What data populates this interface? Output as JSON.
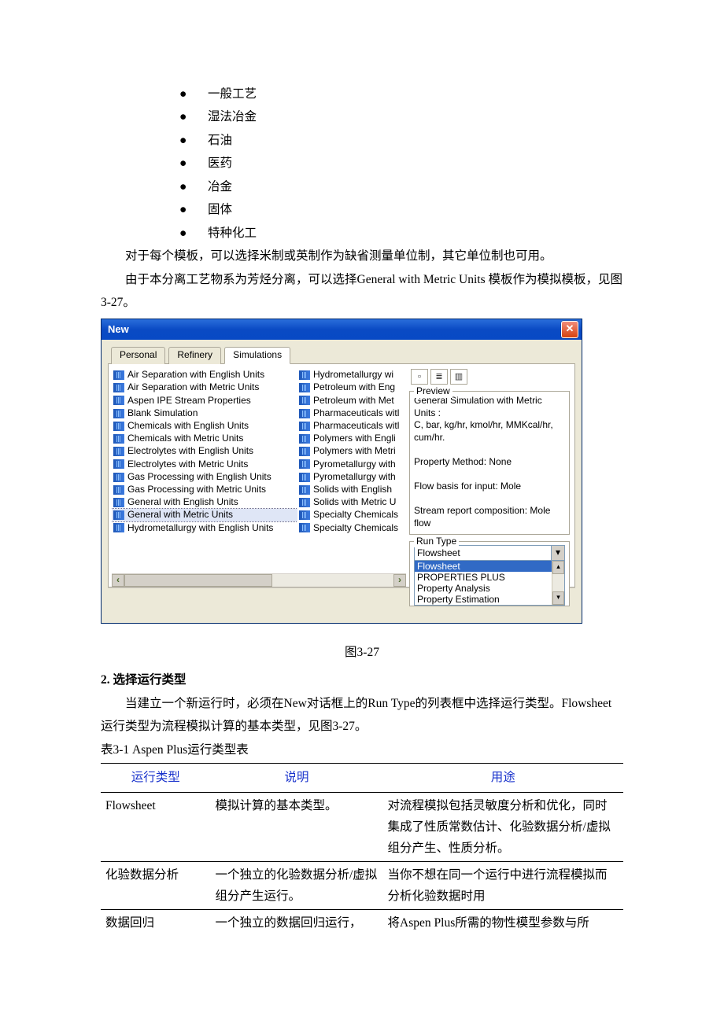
{
  "bullets": [
    "一般工艺",
    "湿法冶金",
    "石油",
    "医药",
    "冶金",
    "固体",
    "特种化工"
  ],
  "para1": "对于每个模板，可以选择米制或英制作为缺省测量单位制，其它单位制也可用。",
  "para2": "由于本分离工艺物系为芳烃分离，可以选择General with Metric Units 模板作为模拟模板，见图3-27。",
  "dialog": {
    "title": "New",
    "tabs": [
      "Personal",
      "Refinery",
      "Simulations"
    ],
    "active_tab": 2,
    "col1": [
      "Air Separation with English Units",
      "Air Separation with Metric Units",
      "Aspen IPE Stream Properties",
      "Blank Simulation",
      "Chemicals with English Units",
      "Chemicals with Metric Units",
      "Electrolytes with English Units",
      "Electrolytes with Metric Units",
      "Gas Processing with English Units",
      "Gas Processing with Metric Units",
      "General with English Units",
      "General with Metric Units",
      "Hydrometallurgy with English Units"
    ],
    "selected_index": 11,
    "col2": [
      "Hydrometallurgy wi",
      "Petroleum with Eng",
      "Petroleum with Met",
      "Pharmaceuticals witl",
      "Pharmaceuticals witl",
      "Polymers with Engli",
      "Polymers with Metri",
      "Pyrometallurgy with",
      "Pyrometallurgy with",
      "Solids with English",
      "Solids with Metric U",
      "Specialty Chemicals",
      "Specialty Chemicals"
    ],
    "preview_legend": "Preview",
    "preview_lines": [
      "General Simulation with Metric Units :",
      "C, bar, kg/hr, kmol/hr, MMKcal/hr, cum/hr.",
      "",
      "Property Method: None",
      "",
      "Flow basis for input: Mole",
      "",
      "Stream report composition: Mole flow"
    ],
    "runtype_legend": "Run Type",
    "runtype_value": "Flowsheet",
    "runtype_options": [
      "Flowsheet",
      "PROPERTIES PLUS",
      "Property Analysis",
      "Property Estimation"
    ],
    "runtype_selected": 0
  },
  "fig_caption": "图3-27",
  "section2_title": "2. 选择运行类型",
  "para3": "当建立一个新运行时，必须在New对话框上的Run Type的列表框中选择运行类型。Flowsheet 运行类型为流程模拟计算的基本类型，见图3-27。",
  "table_caption": "表3-1 Aspen Plus运行类型表",
  "table": {
    "headers": [
      "运行类型",
      "说明",
      "用途"
    ],
    "rows": [
      {
        "c1": "Flowsheet",
        "c2": "模拟计算的基本类型。",
        "c3": "对流程模拟包括灵敏度分析和优化，同时集成了性质常数估计、化验数据分析/虚拟组分产生、性质分析。",
        "sep": true
      },
      {
        "c1": "化验数据分析",
        "c2": "一个独立的化验数据分析/虚拟组分产生运行。",
        "c3": "当你不想在同一个运行中进行流程模拟而分析化验数据时用",
        "sep": true
      },
      {
        "c1": "数据回归",
        "c2": "一个独立的数据回归运行，",
        "c3": "将Aspen Plus所需的物性模型参数与所",
        "sep": false
      }
    ]
  }
}
